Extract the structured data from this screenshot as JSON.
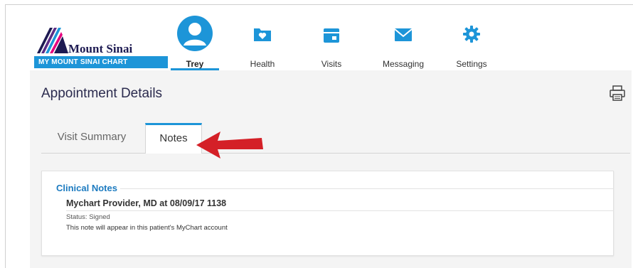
{
  "brand": {
    "name": "Mount Sinai",
    "product": "MY MOUNT SINAI CHART",
    "accent": "#1d95d8",
    "navy": "#1d1a52"
  },
  "nav": {
    "items": [
      {
        "label": "Trey",
        "icon": "user-avatar-icon",
        "active": true
      },
      {
        "label": "Health",
        "icon": "folder-heart-icon"
      },
      {
        "label": "Visits",
        "icon": "calendar-icon"
      },
      {
        "label": "Messaging",
        "icon": "envelope-icon"
      },
      {
        "label": "Settings",
        "icon": "gear-icon"
      }
    ]
  },
  "page": {
    "title": "Appointment Details",
    "print_icon": "printer-icon"
  },
  "tabs": [
    {
      "label": "Visit Summary",
      "active": false
    },
    {
      "label": "Notes",
      "active": true
    }
  ],
  "clinical_notes": {
    "heading": "Clinical Notes",
    "note_title": "Mychart Provider, MD at 08/09/17 1138",
    "status": "Status: Signed",
    "text": "This note will appear in this patient's MyChart account"
  },
  "annotation": {
    "arrow_color": "#d42027",
    "points_to": "Notes tab"
  }
}
